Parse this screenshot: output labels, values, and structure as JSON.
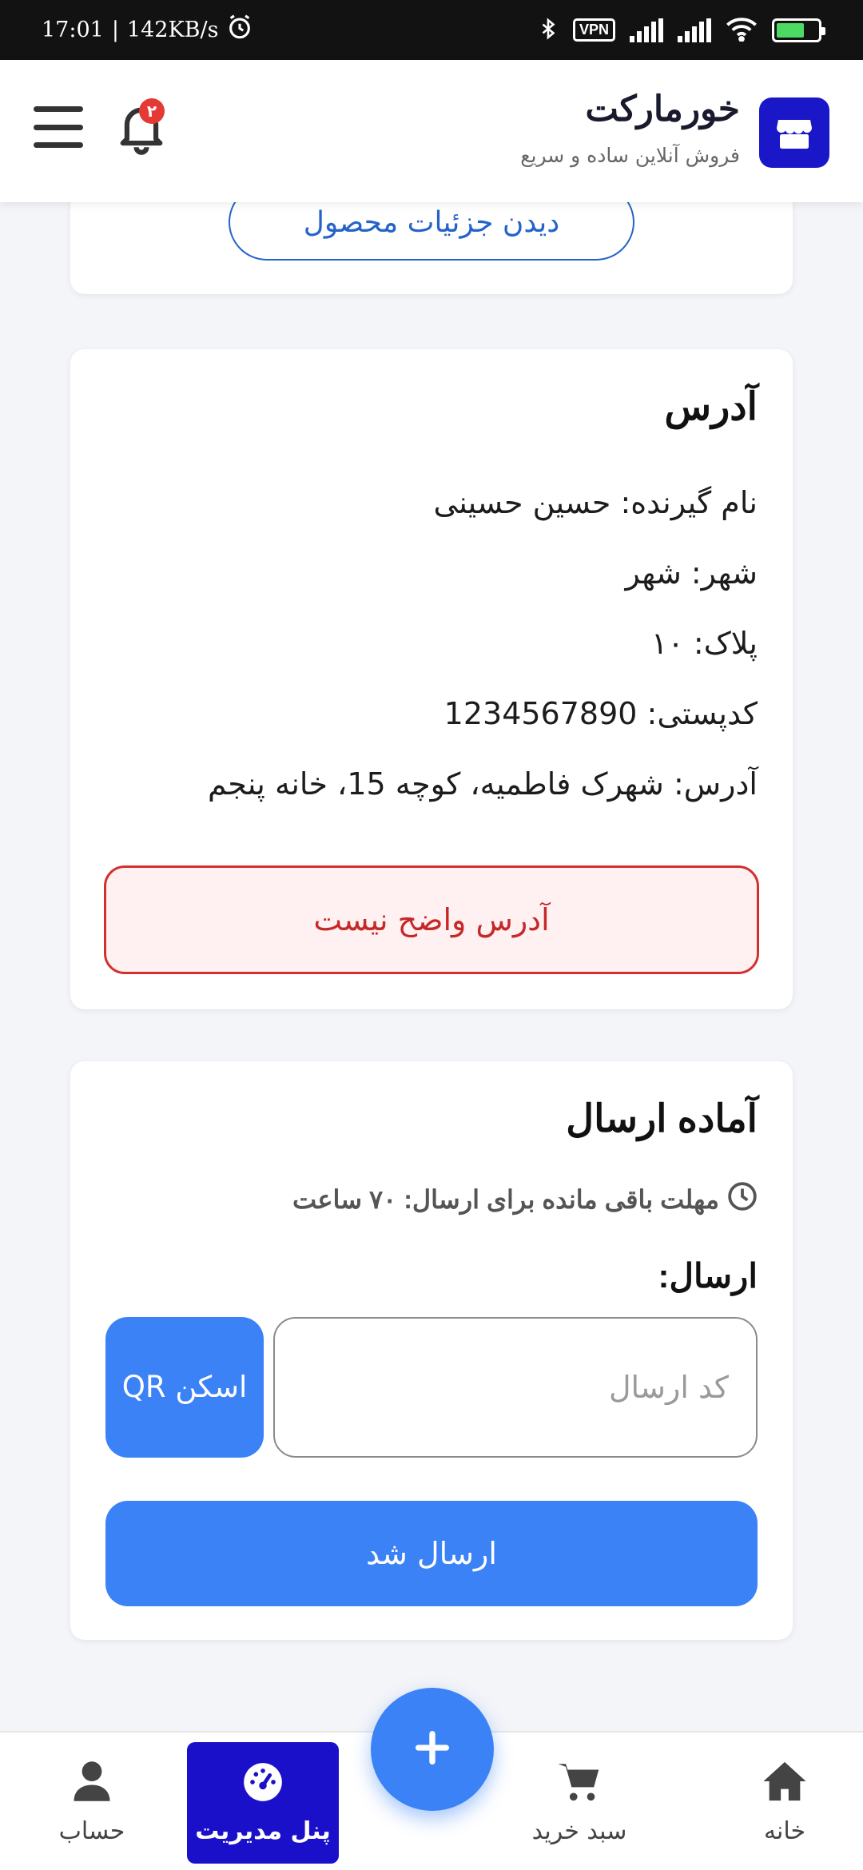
{
  "status_bar": {
    "time": "17:01",
    "speed": "142KB/s",
    "vpn": "VPN"
  },
  "header": {
    "brand": "خورمارکت",
    "tagline": "فروش آنلاین ساده و سریع",
    "notification_count": "۲"
  },
  "product_card": {
    "view_details": "دیدن جزئیات محصول"
  },
  "address_card": {
    "title": "آدرس",
    "recipient": "نام گیرنده: حسین حسینی",
    "city": "شهر: شهر",
    "plate": "پلاک: ۱۰",
    "postal": "کدپستی: 1234567890",
    "address": "آدرس: شهرک فاطمیه، کوچه 15، خانه پنجم",
    "unclear_button": "آدرس واضح نیست"
  },
  "ready_card": {
    "title": "آماده ارسال",
    "deadline": "مهلت باقی مانده برای ارسال: ۷۰ ساعت",
    "send_label": "ارسال:",
    "code_placeholder": "کد ارسال",
    "qr_button": "اسکن QR",
    "sent_button": "ارسال شد"
  },
  "bottom_nav": {
    "home": "خانه",
    "cart": "سبد خرید",
    "admin": "پنل مدیریت",
    "account": "حساب"
  },
  "colors": {
    "brand": "#1a17c8",
    "primary": "#3b82f6",
    "danger": "#d32f2f"
  }
}
